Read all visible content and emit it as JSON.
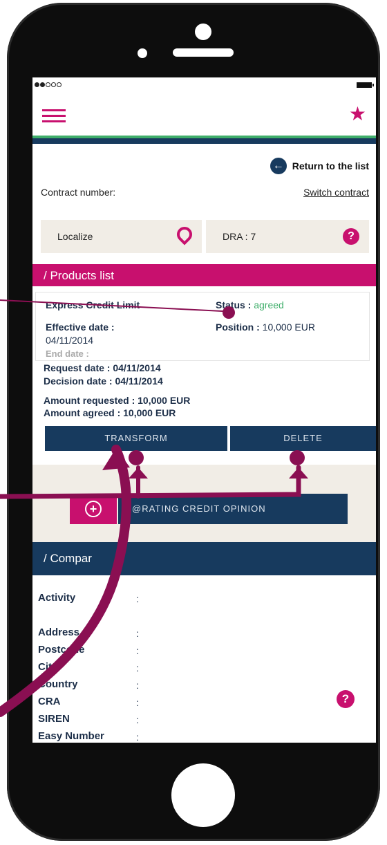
{
  "header": {
    "return_label": "Return to the list",
    "contract_label": "Contract number:",
    "switch_label": "Switch contract"
  },
  "tools": {
    "localize_label": "Localize",
    "dra_label": "DRA : 7"
  },
  "products": {
    "title": "/ Products list",
    "product_name": "Express Credit Limit",
    "status_label": "Status : ",
    "status_value": "agreed",
    "effective_label": "Effective date :",
    "effective_value": "04/11/2014",
    "end_label": "End date :",
    "position_label": "Position : ",
    "position_value": "10,000 EUR",
    "request_label": "Request date : ",
    "request_value": "04/11/2014",
    "decision_label": "Decision date : ",
    "decision_value": "04/11/2014",
    "requested_label": "Amount requested : ",
    "requested_value": "10,000 EUR",
    "agreed_label": "Amount agreed : ",
    "agreed_value": "10,000 EUR",
    "transform_label": "TRANSFORM",
    "delete_label": "DELETE"
  },
  "rating": {
    "label": "@RATING CREDIT OPINION"
  },
  "company": {
    "title": "/ Compar",
    "fields": [
      "Activity",
      "Address",
      "Postcode",
      "City",
      "Country",
      "CRA",
      "SIREN",
      "Easy Number"
    ],
    "colon": ":"
  },
  "colors": {
    "brand_magenta": "#c8106e",
    "navy": "#173a5e",
    "green": "#3fae6a",
    "annotation": "#8a0f52"
  },
  "icons": [
    "star-icon",
    "hamburger-icon",
    "return-arrow-icon",
    "map-pin-icon",
    "help-icon",
    "plus-circle-icon"
  ]
}
